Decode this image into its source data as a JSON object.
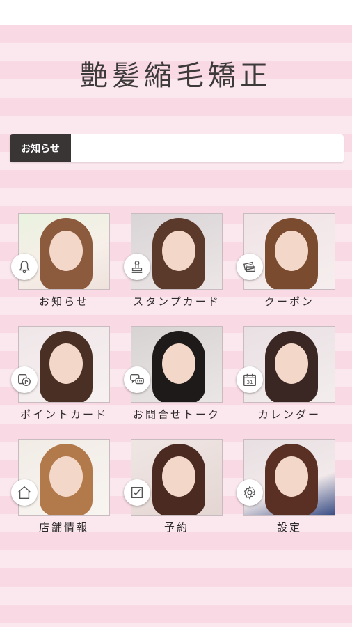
{
  "app": {
    "title": "艶髪縮毛矯正"
  },
  "notice": {
    "label": "お知らせ",
    "text": ""
  },
  "menu": [
    {
      "label": "お知らせ",
      "icon": "bell-icon"
    },
    {
      "label": "スタンプカード",
      "icon": "stamp-icon"
    },
    {
      "label": "クーポン",
      "icon": "coupon-icon"
    },
    {
      "label": "ポイントカード",
      "icon": "point-card-icon"
    },
    {
      "label": "お問合せトーク",
      "icon": "chat-icon"
    },
    {
      "label": "カレンダー",
      "icon": "calendar-icon"
    },
    {
      "label": "店舗情報",
      "icon": "home-icon"
    },
    {
      "label": "予約",
      "icon": "checkbox-icon"
    },
    {
      "label": "設定",
      "icon": "gear-icon"
    }
  ],
  "colors": {
    "stripe_light": "#fbe7ee",
    "stripe_dark": "#f9d9e4",
    "notice_label_bg": "#3a3535",
    "text_dark": "#2f2b2b"
  }
}
